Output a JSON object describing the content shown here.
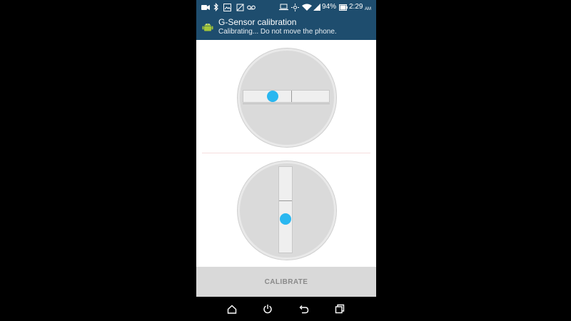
{
  "status_bar": {
    "battery_percent": "94%",
    "time": "2:29",
    "ampm": "AM",
    "icons": [
      "camera-icon",
      "bluetooth-icon",
      "gallery-icon",
      "sync-icon",
      "voicemail-icon",
      "laptop-icon",
      "nfc-icon",
      "wifi-icon",
      "signal-icon",
      "battery-icon"
    ]
  },
  "app": {
    "title": "G-Sensor calibration",
    "subtitle": "Calibrating...  Do not move the phone.",
    "icon": "android-icon"
  },
  "calibrate_button": {
    "label": "CALIBRATE"
  },
  "nav_bar": {
    "icons": [
      "home-icon",
      "power-icon",
      "back-icon",
      "recents-icon"
    ]
  },
  "colors": {
    "header_bg": "#1e4d6e",
    "bubble": "#2ab7f0",
    "button_bg": "#d9d9d9",
    "button_text": "#8a8a8a"
  }
}
